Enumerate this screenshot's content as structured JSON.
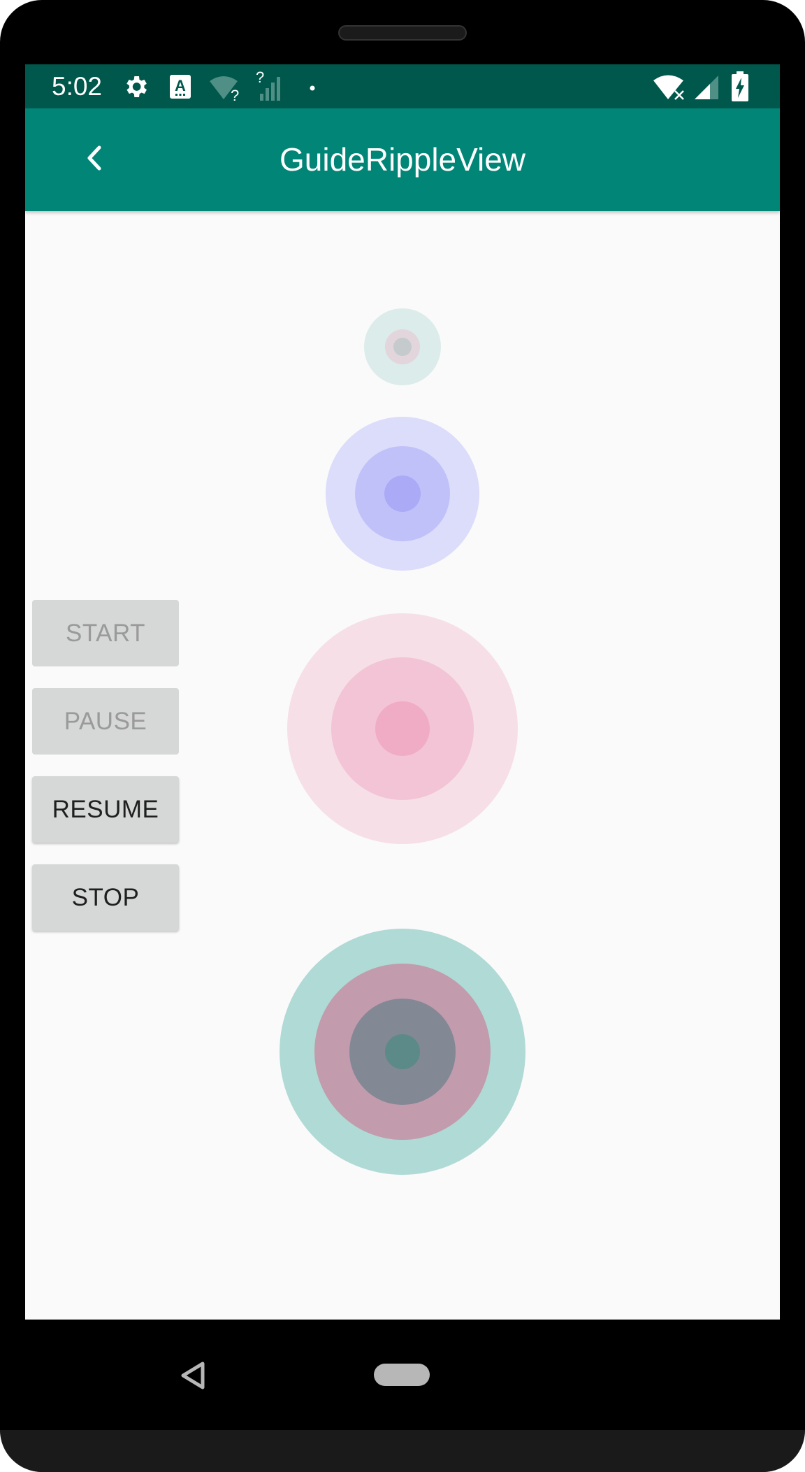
{
  "status_bar": {
    "time": "5:02",
    "icons_left": [
      "settings-icon",
      "keyboard-a-icon",
      "wifi-question-icon",
      "signal-question-icon",
      "dot-icon"
    ],
    "icons_right": [
      "wifi-off-icon",
      "signal-icon",
      "battery-charging-icon"
    ]
  },
  "app_bar": {
    "title": "GuideRippleView",
    "back_icon": "chevron-left-icon"
  },
  "buttons": [
    {
      "label": "START",
      "enabled": false
    },
    {
      "label": "PAUSE",
      "enabled": false
    },
    {
      "label": "RESUME",
      "enabled": true
    },
    {
      "label": "STOP",
      "enabled": true
    }
  ],
  "ripple_views": [
    {
      "name": "ripple-teal-small",
      "colors": [
        "#dcecea",
        "#e2d5dc",
        "#c5cacc"
      ]
    },
    {
      "name": "ripple-indigo",
      "colors": [
        "#dcdcfb",
        "#c1c1fa",
        "#aaaaf6"
      ]
    },
    {
      "name": "ripple-pink",
      "colors": [
        "#f6dfe6",
        "#f2c4d5",
        "#efacc4"
      ]
    },
    {
      "name": "ripple-teal-large",
      "colors": [
        "#b0dad5",
        "#c29bad",
        "#828894",
        "#5b8a89"
      ]
    }
  ],
  "nav_bar": {
    "icons": [
      "back-triangle-icon",
      "home-pill-icon"
    ]
  }
}
